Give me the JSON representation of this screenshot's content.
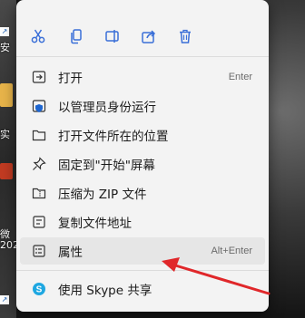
{
  "desktop": {
    "labels": [
      "安",
      "实",
      "微",
      "202"
    ]
  },
  "toolbar": {
    "buttons": [
      {
        "name": "cut-icon",
        "color": "#3a6fd8"
      },
      {
        "name": "copy-icon",
        "color": "#3a6fd8"
      },
      {
        "name": "rename-icon",
        "color": "#3a6fd8"
      },
      {
        "name": "share-icon",
        "color": "#3a6fd8"
      },
      {
        "name": "delete-icon",
        "color": "#3a6fd8"
      }
    ]
  },
  "menu": {
    "items": [
      {
        "label": "打开",
        "shortcut": "Enter",
        "icon": "open-icon"
      },
      {
        "label": "以管理员身份运行",
        "shortcut": "",
        "icon": "admin-shield-icon"
      },
      {
        "label": "打开文件所在的位置",
        "shortcut": "",
        "icon": "folder-icon"
      },
      {
        "label": "固定到\"开始\"屏幕",
        "shortcut": "",
        "icon": "pin-icon"
      },
      {
        "label": "压缩为 ZIP 文件",
        "shortcut": "",
        "icon": "zip-icon"
      },
      {
        "label": "复制文件地址",
        "shortcut": "",
        "icon": "copy-path-icon"
      },
      {
        "label": "属性",
        "shortcut": "Alt+Enter",
        "icon": "properties-icon"
      },
      {
        "label": "使用 Skype 共享",
        "shortcut": "",
        "icon": "skype-icon"
      }
    ]
  },
  "colors": {
    "menu_bg": "#f3f3f3",
    "accent": "#3a6fd8",
    "annotation": "#e0272a",
    "skype": "#1ea7e1"
  }
}
